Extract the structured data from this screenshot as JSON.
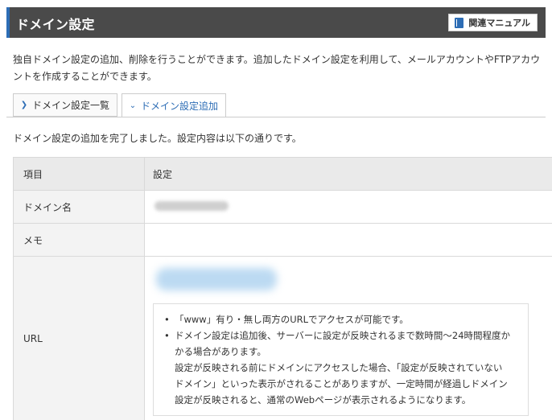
{
  "header": {
    "title": "ドメイン設定",
    "manual_label": "関連マニュアル"
  },
  "intro": {
    "line1": "独自ドメイン設定の追加、削除を行うことができます。追加したドメイン設定を利用して、メールアカウントやFTPアカウ",
    "line2": "ントを作成することができます。"
  },
  "tabs": [
    {
      "label": "ドメイン設定一覧",
      "active": false
    },
    {
      "label": "ドメイン設定追加",
      "active": true
    }
  ],
  "done_message": "ドメイン設定の追加を完了しました。設定内容は以下の通りです。",
  "table": {
    "header": {
      "label": "項目",
      "value": "設定"
    },
    "rows": {
      "domain": {
        "label": "ドメイン名"
      },
      "memo": {
        "label": "メモ",
        "value": ""
      },
      "url": {
        "label": "URL"
      }
    }
  },
  "notes": {
    "item1": "「www」有り・無し両方のURLでアクセスが可能です。",
    "item2_l1": "ドメイン設定は追加後、サーバーに設定が反映されるまで数時間〜24時間程度か",
    "item2_l2": "かる場合があります。",
    "item2_l3": "設定が反映される前にドメインにアクセスした場合、「設定が反映されていない",
    "item2_l4": "ドメイン」といった表示がされることがありますが、一定時間が経過しドメイン",
    "item2_l5": "設定が反映されると、通常のWebページが表示されるようになります。"
  },
  "colors": {
    "header_bg": "#4a4a4a",
    "accent": "#2d6db5",
    "table_label_bg": "#f3f3f3"
  }
}
